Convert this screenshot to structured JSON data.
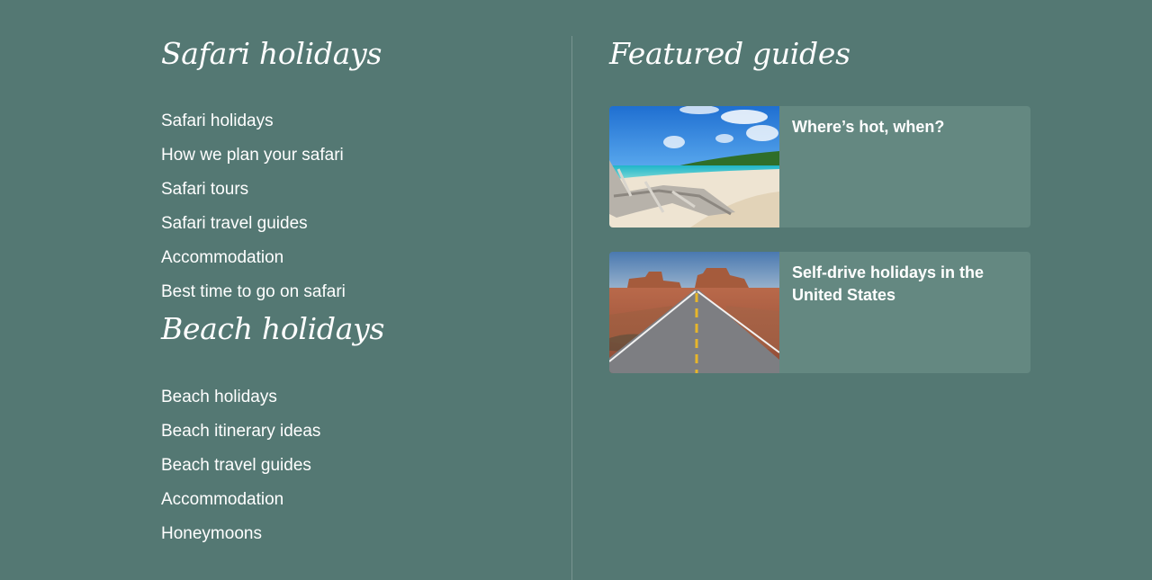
{
  "safari": {
    "heading": "Safari holidays",
    "links": [
      "Safari holidays",
      "How we plan your safari",
      "Safari tours",
      "Safari travel guides",
      "Accommodation",
      "Best time to go on safari"
    ]
  },
  "beach": {
    "heading": "Beach holidays",
    "links": [
      "Beach holidays",
      "Beach itinerary ideas",
      "Beach travel guides",
      "Accommodation",
      "Honeymoons"
    ]
  },
  "featured": {
    "heading": "Featured guides",
    "guides": [
      {
        "title": "Where’s hot, when?",
        "image": "beach-driftwood-photo"
      },
      {
        "title": "Self-drive holidays in the United States",
        "image": "desert-road-photo"
      }
    ]
  },
  "colors": {
    "background": "#547873",
    "card": "#648881",
    "text": "#ffffff"
  }
}
